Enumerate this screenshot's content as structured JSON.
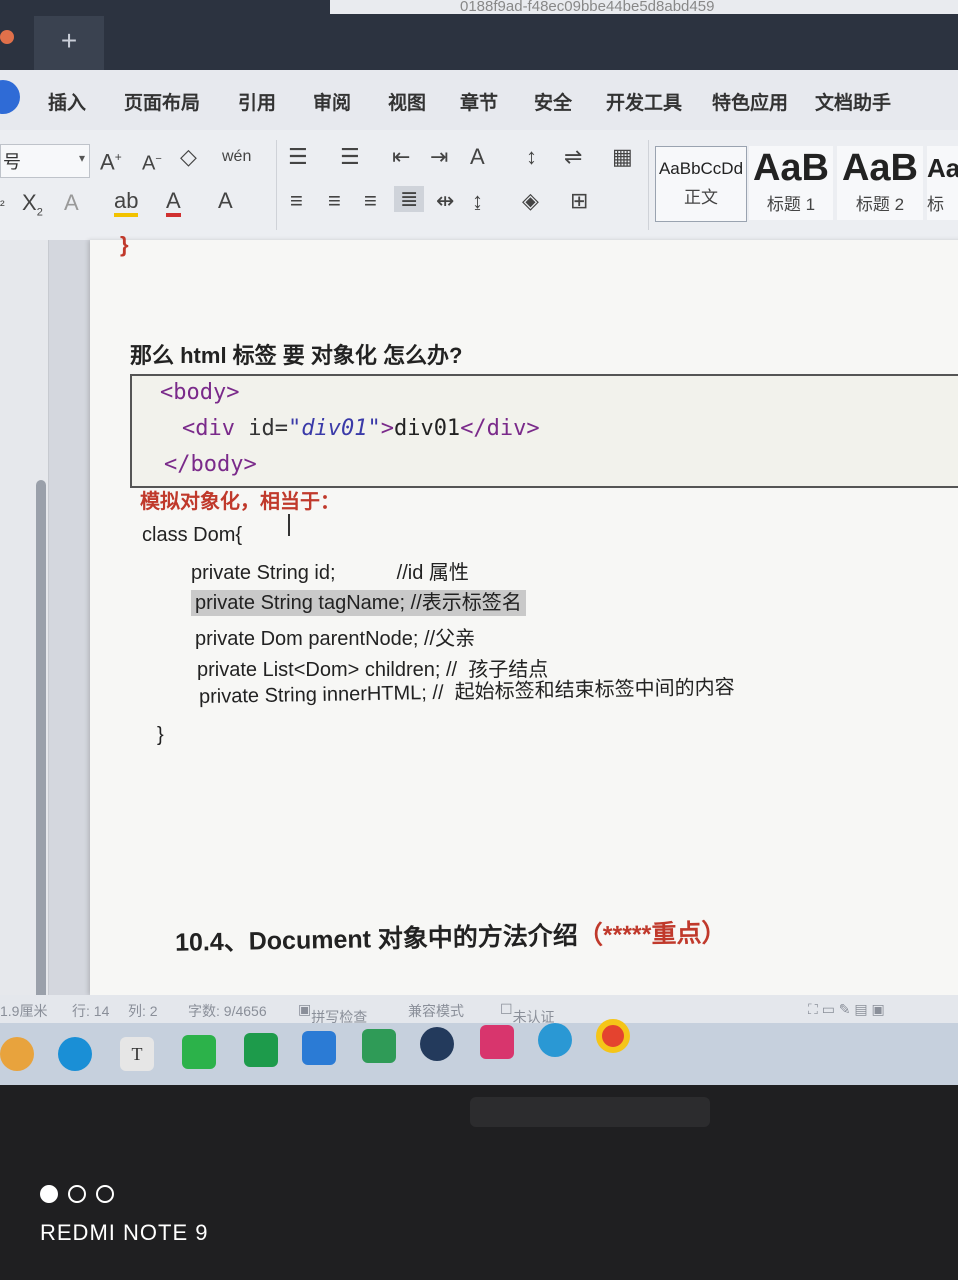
{
  "window": {
    "tab_title": "0188f9ad-f48ec09bbe44be5d8abd459",
    "new_tab_label": "+"
  },
  "menu": {
    "items": [
      "插入",
      "页面布局",
      "引用",
      "审阅",
      "视图",
      "章节",
      "安全",
      "开发工具",
      "特色应用",
      "文档助手"
    ]
  },
  "ribbon": {
    "font_size_value": "号",
    "styles": [
      {
        "sample": "AaBbCcDd",
        "caption": "正文"
      },
      {
        "sample": "AaB",
        "caption": "标题 1"
      },
      {
        "sample": "AaB",
        "caption": "标题 2"
      },
      {
        "sample": "Aa",
        "caption": "标"
      }
    ]
  },
  "document": {
    "closing_brace": "}",
    "heading": "那么 html 标签 要 对象化 怎么办?",
    "code": {
      "line1_open": "<body>",
      "line2_tag_open": "<div ",
      "line2_attr": "id=",
      "line2_value": "\"div01\"",
      "line2_close_bracket": ">",
      "line2_text": "div01",
      "line2_end_tag": "</div>",
      "line3_close": "</body>"
    },
    "note": "模拟对象化，相当于：",
    "class_lines": [
      "class Dom{",
      "private String id;           //id 属性",
      "private String tagName; //表示标签名",
      "private Dom parentNode; //父亲",
      "private List<Dom> children; //  孩子结点",
      "private String innerHTML; //  起始标签和结束标签中间的内容",
      "}"
    ],
    "section_title": "10.4、Document 对象中的方法介绍",
    "section_suffix": "（*****重点）"
  },
  "statusbar": {
    "position": "1.9厘米",
    "line": "行: 14",
    "column": "列: 2",
    "word_count": "字数: 9/4656",
    "spell_check": "拼写检查",
    "compat_mode": "兼容模式",
    "auth": "未认证"
  },
  "taskbar": {
    "icons": [
      "windows-icon",
      "edge-icon",
      "typora-icon",
      "wechat-icon",
      "pycharm-icon",
      "vscode-icon",
      "qq-icon",
      "qq-penguin-icon",
      "idea-icon",
      "edge-dev-icon",
      "chrome-icon"
    ]
  },
  "watermark": {
    "text": "REDMI NOTE 9"
  }
}
